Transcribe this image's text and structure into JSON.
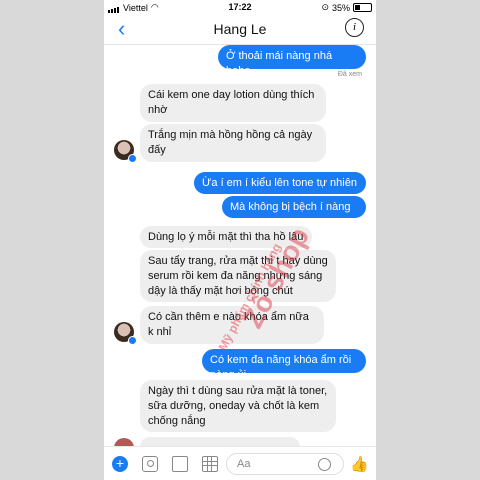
{
  "status_bar": {
    "carrier": "Viettel",
    "time": "17:22",
    "battery": "35%"
  },
  "header": {
    "back_icon": "back-arrow-icon",
    "title": "Hang Le",
    "info_icon": "info-icon"
  },
  "messages": [
    {
      "side": "out",
      "text": "Ở thoải mái nàng nhá hehe"
    },
    {
      "side": "in",
      "text": "Cái kem one day lotion dùng thích nhờ"
    },
    {
      "side": "in",
      "text": "Trắng mịn mà hồng hồng cả ngày đấy"
    },
    {
      "side": "out",
      "text": "Ừa í em í kiểu lên tone tự nhiên"
    },
    {
      "side": "out",
      "text": "Mà không bị bệch í nàng"
    },
    {
      "side": "in",
      "text": "Dùng lọ ý mỗi mặt thì tha hồ lâu"
    },
    {
      "side": "in",
      "text": "Sau tẩy trang, rửa mặt thì t hay dùng serum rồi kem đa năng nhưng sáng dậy là thấy mặt hơi bóng chút"
    },
    {
      "side": "in",
      "text": "Có cần thêm e nào khóa ẩm nữa k nhỉ"
    },
    {
      "side": "out",
      "text": "Có kem đa năng khóa ẩm rồi nàng ủi"
    },
    {
      "side": "in",
      "text": "Ngày thì t dùng sau rửa mặt là toner, sữa dưỡng, oneday và chốt là kem chống nắng"
    }
  ],
  "seen_label": "Đã xem",
  "watermark": {
    "small": "Mỹ phẩm chính hãng",
    "large": "Zô shop"
  },
  "composer": {
    "placeholder": "Aa"
  },
  "colors": {
    "accent": "#1a7cf5",
    "incoming_bubble": "#eeeeee"
  }
}
